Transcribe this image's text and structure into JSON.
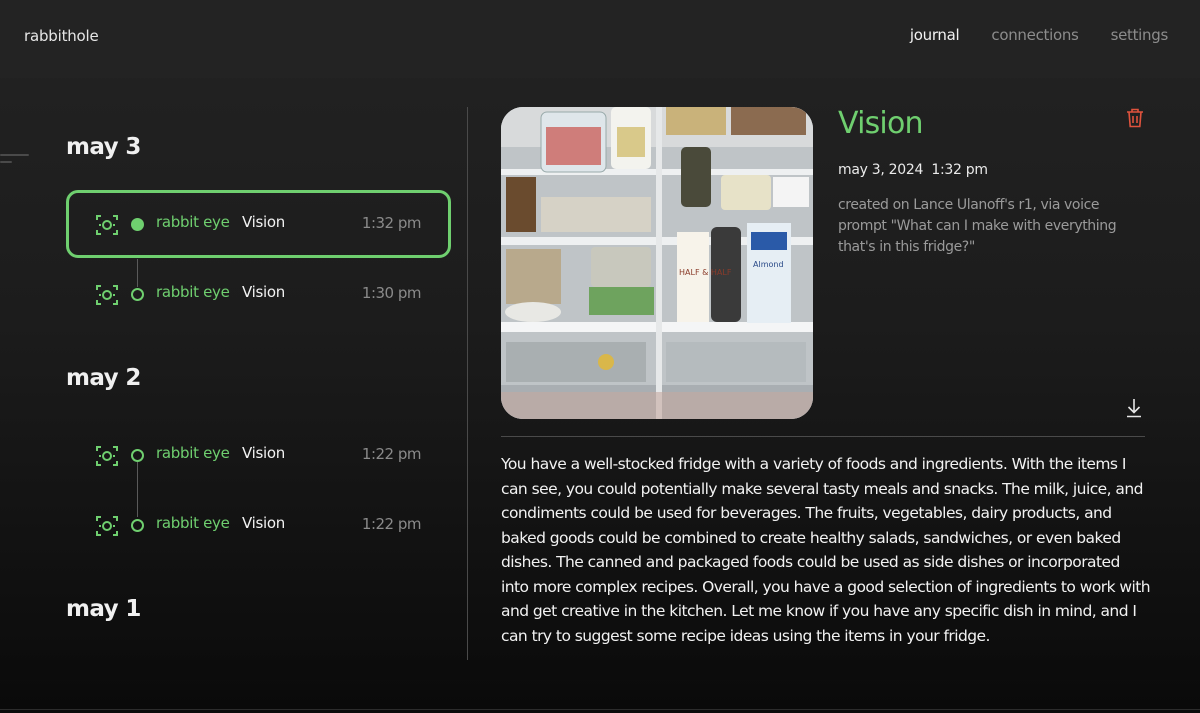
{
  "app": {
    "brand": "rabbithole"
  },
  "nav": {
    "journal": "journal",
    "connections": "connections",
    "settings": "settings"
  },
  "days": [
    {
      "label": "may 3"
    },
    {
      "label": "may 2"
    },
    {
      "label": "may 1"
    }
  ],
  "entries": [
    {
      "source": "rabbit eye",
      "title": "Vision",
      "time": "1:32 pm",
      "selected": true
    },
    {
      "source": "rabbit eye",
      "title": "Vision",
      "time": "1:30 pm",
      "selected": false
    },
    {
      "source": "rabbit eye",
      "title": "Vision",
      "time": "1:22 pm",
      "selected": false
    },
    {
      "source": "rabbit eye",
      "title": "Vision",
      "time": "1:22 pm",
      "selected": false
    }
  ],
  "detail": {
    "title": "Vision",
    "date": "may 3, 2024  1:32 pm",
    "meta": "created on Lance Ulanoff's r1, via voice prompt \"What can I make with everything that's in this fridge?\"",
    "photo_labels": {
      "carton1": "HALF & HALF",
      "carton2": "Almond"
    },
    "response": "You have a well-stocked fridge with a variety of foods and ingredients. With the items I can see, you could potentially make several tasty meals and snacks. The milk, juice, and condiments could be used for beverages. The fruits, vegetables, dairy products, and baked goods could be combined to create healthy salads, sandwiches, or even baked dishes. The canned and packaged foods could be used as side dishes or incorporated into more complex recipes. Overall, you have a good selection of ingredients to work with and get creative in the kitchen. Let me know if you have any specific dish in mind, and I can try to suggest some recipe ideas using the items in your fridge."
  },
  "colors": {
    "accent": "#6fcf6f",
    "danger": "#e0533d",
    "background": "#1c1c1c"
  },
  "icons": {
    "entry": "camera-focus-icon",
    "delete": "trash-icon",
    "download": "download-icon"
  }
}
